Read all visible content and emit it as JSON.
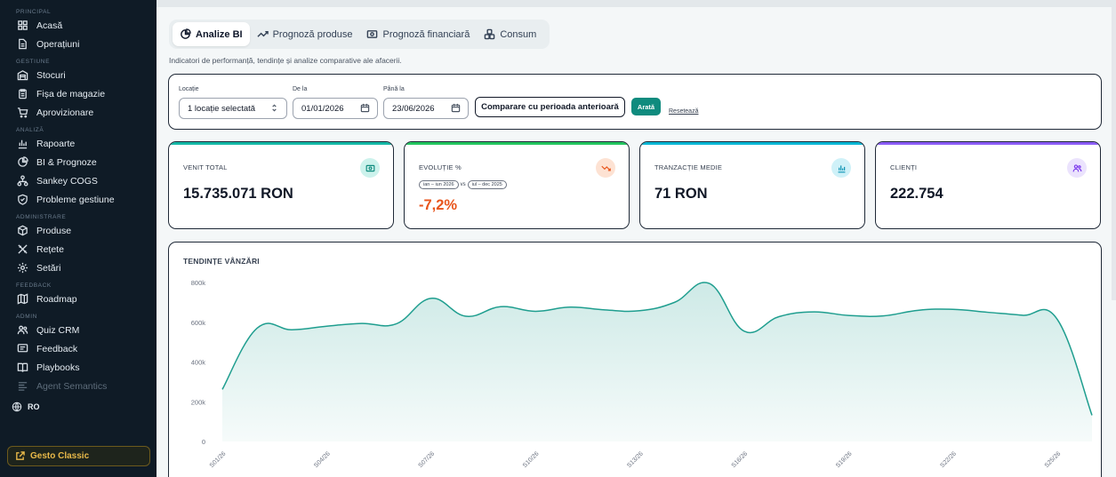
{
  "sidebar": {
    "sections": [
      {
        "title": "PRINCIPAL",
        "items": [
          {
            "label": "Acasă",
            "icon": "grid-icon"
          },
          {
            "label": "Operațiuni",
            "icon": "document-icon"
          }
        ]
      },
      {
        "title": "GESTIUNE",
        "items": [
          {
            "label": "Stocuri",
            "icon": "warehouse-icon"
          },
          {
            "label": "Fișa de magazie",
            "icon": "clipboard-icon"
          },
          {
            "label": "Aprovizionare",
            "icon": "cart-icon"
          }
        ]
      },
      {
        "title": "ANALIZĂ",
        "items": [
          {
            "label": "Rapoarte",
            "icon": "bar-chart-icon"
          },
          {
            "label": "BI & Prognoze",
            "icon": "pie-chart-icon"
          },
          {
            "label": "Sankey COGS",
            "icon": "network-icon"
          },
          {
            "label": "Probleme gestiune",
            "icon": "shield-check-icon"
          }
        ]
      },
      {
        "title": "ADMINISTRARE",
        "items": [
          {
            "label": "Produse",
            "icon": "box-icon"
          },
          {
            "label": "Rețete",
            "icon": "utensils-icon"
          },
          {
            "label": "Setări",
            "icon": "gear-icon"
          }
        ]
      },
      {
        "title": "FEEDBACK",
        "items": [
          {
            "label": "Roadmap",
            "icon": "map-icon"
          }
        ]
      },
      {
        "title": "ADMIN",
        "items": [
          {
            "label": "Quiz CRM",
            "icon": "users-icon"
          },
          {
            "label": "Feedback",
            "icon": "message-icon"
          },
          {
            "label": "Playbooks",
            "icon": "book-icon"
          },
          {
            "label": "Agent Semantics",
            "icon": "list-icon"
          }
        ]
      }
    ],
    "language": "RO",
    "classic_button": "Gesto Classic"
  },
  "tabs": [
    {
      "label": "Analize BI",
      "icon": "pie-chart-icon",
      "active": true
    },
    {
      "label": "Prognoză produse",
      "icon": "trend-up-icon",
      "active": false
    },
    {
      "label": "Prognoză financiară",
      "icon": "money-icon",
      "active": false
    },
    {
      "label": "Consum",
      "icon": "boxes-icon",
      "active": false
    }
  ],
  "subtitle": "Indicatori de performanță, tendințe și analize comparative ale afacerii.",
  "filters": {
    "location_label": "Locație",
    "location_value": "1 locație selectată",
    "from_label": "De la",
    "from_value": "01/01/2026",
    "to_label": "Până la",
    "to_value": "23/06/2026",
    "compare_button": "Comparare cu perioada anterioară",
    "show_button": "Arată",
    "reset_link": "Resetează"
  },
  "kpis": [
    {
      "label": "VENIT TOTAL",
      "value": "15.735.071 RON",
      "icon": "money-icon",
      "accent": "#14b8a6",
      "icon_bg": "#ccf2ec",
      "icon_color": "#0f8b7e"
    },
    {
      "label": "EVOLUȚIE %",
      "value": "-7,2%",
      "icon": "trend-down-icon",
      "accent": "#22c55e",
      "icon_bg": "#fde2d3",
      "icon_color": "#e8551c",
      "period_a": "ian – iun 2026",
      "vs": "vs",
      "period_b": "iul – dec 2025"
    },
    {
      "label": "TRANZACȚIE MEDIE",
      "value": "71 RON",
      "icon": "bar-chart-icon",
      "accent": "#06b6d4",
      "icon_bg": "#cff1f8",
      "icon_color": "#0891b2"
    },
    {
      "label": "CLIENȚI",
      "value": "222.754",
      "icon": "users-icon",
      "accent": "#8b5cf6",
      "icon_bg": "#ebe3fd",
      "icon_color": "#7c3aed"
    }
  ],
  "chart_title": "TENDINȚE VÂNZĂRI",
  "chart_data": {
    "type": "area",
    "x_ticks": [
      "S01/26",
      "S04/26",
      "S07/26",
      "S10/26",
      "S13/26",
      "S16/26",
      "S19/26",
      "S22/26",
      "S25/26"
    ],
    "y_ticks": [
      "0",
      "200k",
      "400k",
      "600k",
      "800k"
    ],
    "ylim": [
      0,
      800000
    ],
    "x": [
      1,
      2,
      3,
      4,
      5,
      6,
      7,
      8,
      9,
      10,
      11,
      12,
      13,
      14,
      15,
      16,
      17,
      18,
      19,
      20,
      21,
      22,
      23,
      24,
      25,
      26
    ],
    "values": [
      262000,
      570000,
      562000,
      580000,
      594000,
      592000,
      720000,
      630000,
      678000,
      655000,
      676000,
      662000,
      658000,
      700000,
      795000,
      555000,
      628000,
      652000,
      634000,
      632000,
      660000,
      665000,
      650000,
      635000,
      615000,
      132000
    ],
    "line_color": "#1f9e8f",
    "grid": false
  }
}
